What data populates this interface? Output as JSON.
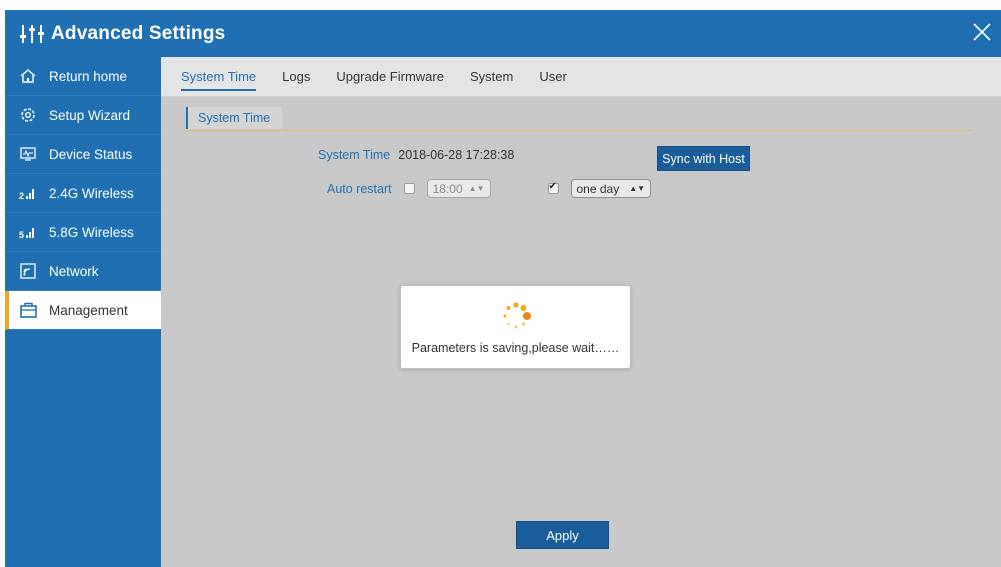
{
  "window": {
    "title": "Advanced Settings",
    "accent": "#1f6fb2"
  },
  "sidebar": {
    "items": [
      {
        "label": "Return home",
        "icon": "home-icon"
      },
      {
        "label": "Setup Wizard",
        "icon": "gear-icon"
      },
      {
        "label": "Device Status",
        "icon": "monitor-icon"
      },
      {
        "label": "2.4G Wireless",
        "icon": "signal-24g-icon"
      },
      {
        "label": "5.8G Wireless",
        "icon": "signal-58g-icon"
      },
      {
        "label": "Network",
        "icon": "network-icon"
      },
      {
        "label": "Management",
        "icon": "briefcase-icon",
        "active": true
      }
    ]
  },
  "tabs": [
    {
      "label": "System Time",
      "active": true
    },
    {
      "label": "Logs"
    },
    {
      "label": "Upgrade Firmware"
    },
    {
      "label": "System"
    },
    {
      "label": "User"
    }
  ],
  "subtab": {
    "label": "System Time"
  },
  "system_time": {
    "label": "System Time",
    "value": "2018-06-28 17:28:38",
    "sync_button": "Sync with Host"
  },
  "auto_restart": {
    "label": "Auto restart",
    "time_checked": false,
    "time_value": "18:00",
    "period_checked": true,
    "period_value": "one day"
  },
  "modal": {
    "message": "Parameters is saving,please wait……",
    "spinner_color": "#f0a81f"
  },
  "apply_button": "Apply"
}
